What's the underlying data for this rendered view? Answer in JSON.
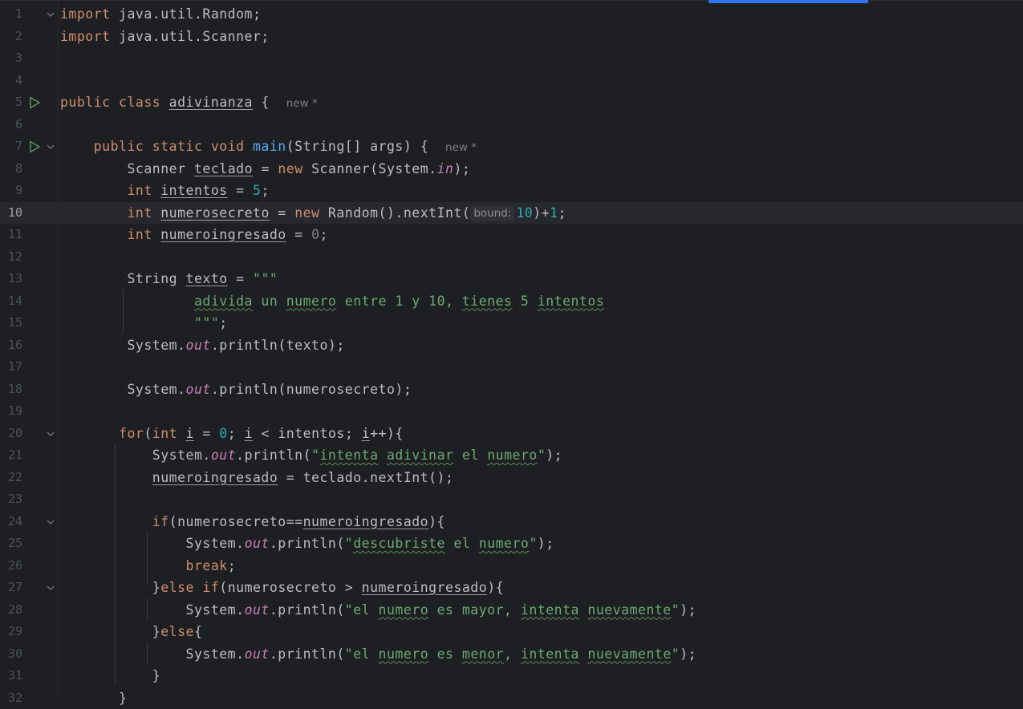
{
  "editor": {
    "current_line": 10,
    "line_numbers": [
      "1",
      "2",
      "3",
      "4",
      "5",
      "6",
      "7",
      "8",
      "9",
      "10",
      "11",
      "12",
      "13",
      "14",
      "15",
      "16",
      "17",
      "18",
      "19",
      "20",
      "21",
      "22",
      "23",
      "24",
      "25",
      "26",
      "27",
      "28",
      "29",
      "30",
      "31",
      "32"
    ],
    "hints": {
      "new": "new *",
      "bound": "bound:"
    },
    "code": {
      "import_kw": "import",
      "import_random": " java.util.Random;",
      "import_scanner": " java.util.Scanner;",
      "class_decl": "public class",
      "class_name": "adivinanza",
      "brace_open": " {",
      "main_mods": "public static void",
      "main_name": "main",
      "main_params": "(String[] args) {",
      "scanner_type": "Scanner",
      "scanner_var": "teclado",
      "assign": " = ",
      "new_kw": "new",
      "scanner_ctor": " Scanner(System.",
      "in_field": "in",
      "close_paren_semi": ");",
      "int_kw": "int",
      "intentos_var": "intentos",
      "five": "5",
      "semi": ";",
      "secreto_var": "numerosecreto",
      "random_call": " Random().nextInt(",
      "ten": "10",
      "plus": ")+",
      "one": "1",
      "ingresado_var": "numeroingresado",
      "zero": "0",
      "string_type": "String",
      "texto_var": "texto",
      "triple_quote": "\"\"\"",
      "text_words": [
        "adivida",
        " un ",
        "numero",
        " entre 1 y 10, ",
        "tienes",
        " 5 ",
        "intentos"
      ],
      "system_dot": "System.",
      "out_field": "out",
      "println_texto": ".println(texto);",
      "println_secreto": ".println(numerosecreto);",
      "for_kw": "for",
      "loop_i": "i",
      "loop_cond": " < intentos; ",
      "loop_inc": "++){",
      "println_open": ".println(",
      "quote": "\"",
      "str_intenta": "intenta",
      "str_adivinar": "adivinar",
      "str_el": " el ",
      "str_numero": "numero",
      "sp": " ",
      "next_int": " = teclado.nextInt();",
      "if_kw": "if",
      "if_eq_cond": "(numerosecreto==",
      "brace_close_open": "){",
      "str_descubriste": "descubriste",
      "break_kw": "break",
      "close_brace": "}",
      "else_kw": "else",
      "if_gt_cond": "(numerosecreto > ",
      "str_el_pre": "el ",
      "str_es_mayor": " es mayor, ",
      "str_es": " es ",
      "str_menor": "menor",
      "str_comma": ", ",
      "str_nuevamente": "nuevamente",
      "else_open": "{"
    }
  }
}
